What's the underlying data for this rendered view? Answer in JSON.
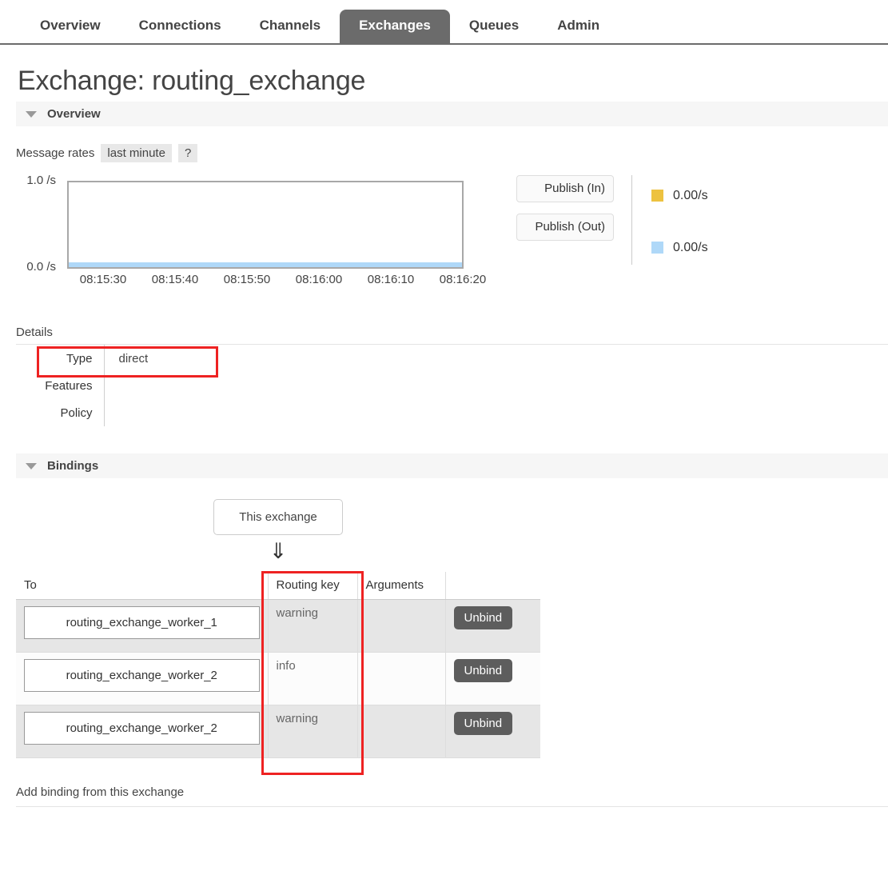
{
  "nav": {
    "items": [
      {
        "label": "Overview",
        "active": false
      },
      {
        "label": "Connections",
        "active": false
      },
      {
        "label": "Channels",
        "active": false
      },
      {
        "label": "Exchanges",
        "active": true
      },
      {
        "label": "Queues",
        "active": false
      },
      {
        "label": "Admin",
        "active": false
      }
    ]
  },
  "page": {
    "title": "Exchange: routing_exchange"
  },
  "overview": {
    "section_label": "Overview",
    "rates_label": "Message rates",
    "period_chip": "last minute",
    "help_chip": "?"
  },
  "chart_data": {
    "type": "line",
    "title": "Message rates",
    "xlabel": "",
    "ylabel": "/s",
    "ylim": [
      0.0,
      1.0
    ],
    "ytick_labels": [
      "1.0 /s",
      "0.0 /s"
    ],
    "yticks": [
      1.0,
      0.0
    ],
    "x": [
      "08:15:30",
      "08:15:40",
      "08:15:50",
      "08:16:00",
      "08:16:10",
      "08:16:20"
    ],
    "grid": false,
    "legend_position": "right",
    "series": [
      {
        "name": "Publish (In)",
        "color": "#edc240",
        "value_label": "0.00/s",
        "values": [
          0,
          0,
          0,
          0,
          0,
          0
        ]
      },
      {
        "name": "Publish (Out)",
        "color": "#afd8f8",
        "value_label": "0.00/s",
        "values": [
          0,
          0,
          0,
          0,
          0,
          0
        ]
      }
    ]
  },
  "details": {
    "label": "Details",
    "rows": [
      {
        "name": "Type",
        "value": "direct"
      },
      {
        "name": "Features",
        "value": ""
      },
      {
        "name": "Policy",
        "value": ""
      }
    ]
  },
  "bindings": {
    "section_label": "Bindings",
    "source_node": "This exchange",
    "arrow_glyph": "⇓",
    "columns": [
      "To",
      "Routing key",
      "Arguments",
      ""
    ],
    "rows": [
      {
        "to": "routing_exchange_worker_1",
        "routing_key": "warning",
        "arguments": "",
        "action": "Unbind"
      },
      {
        "to": "routing_exchange_worker_2",
        "routing_key": "info",
        "arguments": "",
        "action": "Unbind"
      },
      {
        "to": "routing_exchange_worker_2",
        "routing_key": "warning",
        "arguments": "",
        "action": "Unbind"
      }
    ],
    "add_binding_label": "Add binding from this exchange"
  },
  "highlight_color": "#ee2222"
}
